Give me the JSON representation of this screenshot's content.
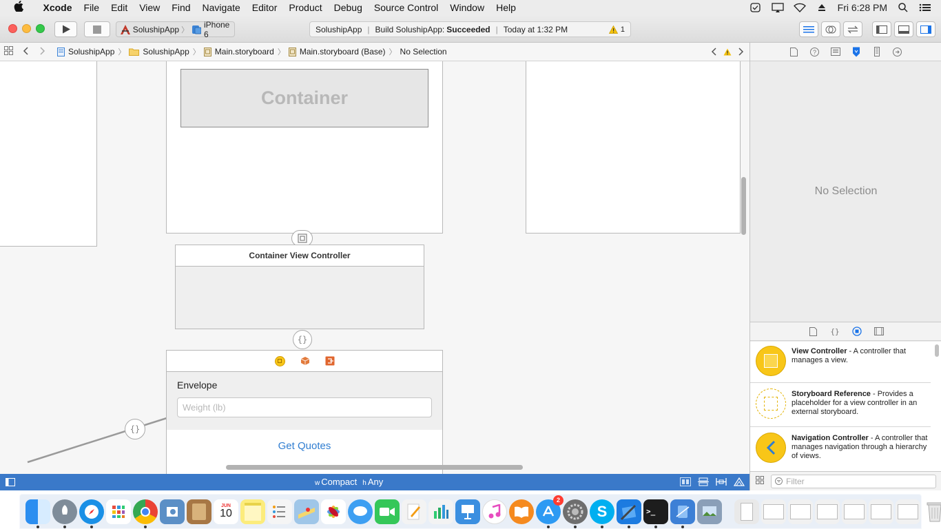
{
  "menubar": {
    "app_name": "Xcode",
    "menus": [
      "File",
      "Edit",
      "View",
      "Find",
      "Navigate",
      "Editor",
      "Product",
      "Debug",
      "Source Control",
      "Window",
      "Help"
    ],
    "clock": "Fri 6:28 PM"
  },
  "toolbar": {
    "scheme_name": "SolushipApp",
    "device_name": "iPhone 6",
    "activity_project": "SolushipApp",
    "activity_prefix": "Build SolushipApp: ",
    "activity_status": "Succeeded",
    "activity_time": "Today at 1:32 PM",
    "warning_count": "1"
  },
  "jumpbar": {
    "crumbs": [
      "SolushipApp",
      "SolushipApp",
      "Main.storyboard",
      "Main.storyboard (Base)",
      "No Selection"
    ]
  },
  "canvas": {
    "container_label": "Container",
    "container_vc_title": "Container View Controller",
    "envelope_label": "Envelope",
    "weight_placeholder": "Weight (lb)",
    "get_quotes_label": "Get Quotes",
    "size_class_w": "w",
    "size_class_w_value": "Compact",
    "size_class_h": "h",
    "size_class_h_value": "Any"
  },
  "inspector": {
    "no_selection": "No Selection",
    "filter_placeholder": "Filter",
    "library_items": [
      {
        "title": "View Controller",
        "description": " - A controller that manages a view."
      },
      {
        "title": "Storyboard Reference",
        "description": " - Provides a placeholder for a view controller in an external storyboard."
      },
      {
        "title": "Navigation Controller",
        "description": " - A controller that manages navigation through a hierarchy of views."
      }
    ]
  },
  "dock": {
    "calendar_month": "JUN",
    "calendar_day": "10",
    "appstore_badge": "2"
  },
  "colors": {
    "accent": "#1a73e8",
    "bottom_bar": "#3a79c9",
    "warning": "#f4c20d",
    "library_yellow": "#f8c618"
  }
}
